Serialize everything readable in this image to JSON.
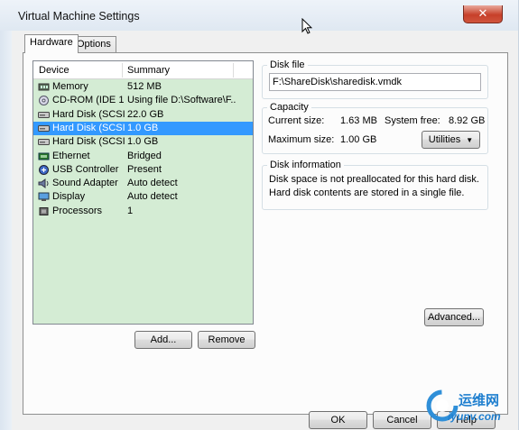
{
  "window": {
    "title": "Virtual Machine Settings",
    "close_glyph": "✕"
  },
  "tabs": [
    {
      "label": "Hardware",
      "active": true
    },
    {
      "label": "Options",
      "active": false
    }
  ],
  "device_list": {
    "columns": [
      "Device",
      "Summary"
    ],
    "rows": [
      {
        "device": "Memory",
        "summary": "512 MB",
        "icon": "memory-icon",
        "selected": false
      },
      {
        "device": "CD-ROM (IDE 1...",
        "summary": "Using file D:\\Software\\F...",
        "icon": "cdrom-icon",
        "selected": false
      },
      {
        "device": "Hard Disk (SCSI...",
        "summary": "22.0 GB",
        "icon": "hard-disk-icon",
        "selected": false
      },
      {
        "device": "Hard Disk (SCSI...",
        "summary": "1.0 GB",
        "icon": "hard-disk-icon",
        "selected": true
      },
      {
        "device": "Hard Disk (SCSI...",
        "summary": "1.0 GB",
        "icon": "hard-disk-icon",
        "selected": false
      },
      {
        "device": "Ethernet",
        "summary": "Bridged",
        "icon": "network-icon",
        "selected": false
      },
      {
        "device": "USB Controller",
        "summary": "Present",
        "icon": "usb-icon",
        "selected": false
      },
      {
        "device": "Sound Adapter",
        "summary": "Auto detect",
        "icon": "speaker-icon",
        "selected": false
      },
      {
        "device": "Display",
        "summary": "Auto detect",
        "icon": "monitor-icon",
        "selected": false
      },
      {
        "device": "Processors",
        "summary": "1",
        "icon": "processor-icon",
        "selected": false
      }
    ],
    "add_label": "Add...",
    "remove_label": "Remove"
  },
  "disk_file": {
    "label": "Disk file",
    "value": "F:\\ShareDisk\\sharedisk.vmdk"
  },
  "capacity": {
    "label": "Capacity",
    "current_size_label": "Current size:",
    "current_size": "1.63 MB",
    "system_free_label": "System free:",
    "system_free": "8.92 GB",
    "maximum_size_label": "Maximum size:",
    "maximum_size": "1.00 GB",
    "utilities_label": "Utilities"
  },
  "disk_info": {
    "label": "Disk information",
    "line1": "Disk space is not preallocated for this hard disk.",
    "line2": "Hard disk contents are stored in a single file."
  },
  "advanced_label": "Advanced...",
  "footer": {
    "ok": "OK",
    "cancel": "Cancel",
    "help": "Help"
  },
  "watermark": {
    "cn": "运维网",
    "url": "iyunv.com"
  },
  "colors": {
    "selection": "#3399ff",
    "list_bg": "#d4ecd4"
  }
}
